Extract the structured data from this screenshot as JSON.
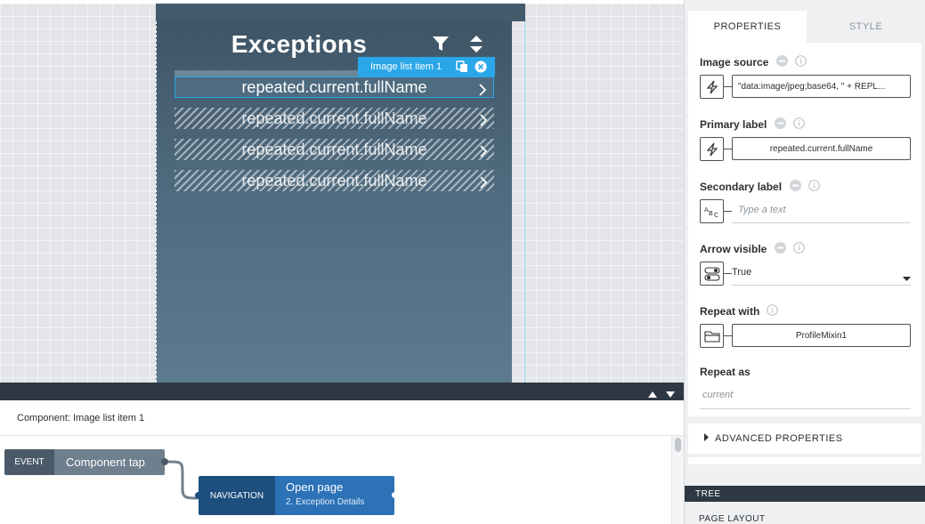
{
  "canvas": {
    "page_title": "Exceptions",
    "selected_tag_label": "Image list item 1",
    "list_items": [
      {
        "label": "repeated.current.fullName"
      },
      {
        "label": "repeated.current.fullName"
      },
      {
        "label": "repeated.current.fullName"
      },
      {
        "label": "repeated.current.fullName"
      }
    ]
  },
  "logic": {
    "component_label": "Component: Image list item 1",
    "event": {
      "type": "EVENT",
      "name": "Component tap"
    },
    "action": {
      "type": "NAVIGATION",
      "title": "Open page",
      "subtitle": "2. Exception Details"
    }
  },
  "panel": {
    "tabs": [
      "PROPERTIES",
      "STYLE"
    ],
    "properties": {
      "image_source": {
        "label": "Image source",
        "value": "\"data:image/jpeg;base64, \" + REPL..."
      },
      "primary_label": {
        "label": "Primary label",
        "value": "repeated.current.fullName"
      },
      "secondary_label": {
        "label": "Secondary label",
        "placeholder": "Type a text"
      },
      "arrow_visible": {
        "label": "Arrow visible",
        "value": "True"
      },
      "repeat_with": {
        "label": "Repeat with",
        "value": "ProfileMixin1"
      },
      "repeat_as": {
        "label": "Repeat as",
        "placeholder": "current"
      }
    },
    "advanced_label": "ADVANCED PROPERTIES",
    "tree_label": "TREE",
    "page_layout_label": "PAGE LAYOUT"
  },
  "colors": {
    "accent": "#2aa7e8",
    "phone_top": "#3f5566",
    "navigation_dark": "#1c4e7e",
    "navigation_light": "#2d72b7",
    "event_dark": "#4b5a68",
    "toolbar_dark": "#2d3842"
  },
  "icons": {
    "header": [
      "filter-icon",
      "sort-icon"
    ],
    "tag": [
      "copy-icon",
      "close-circle-icon"
    ],
    "list": "chevron-right-icon",
    "props": [
      "bolt-icon",
      "text-abc-icon",
      "toggle-icon",
      "folder-icon",
      "link-broken-icon",
      "info-icon"
    ]
  }
}
